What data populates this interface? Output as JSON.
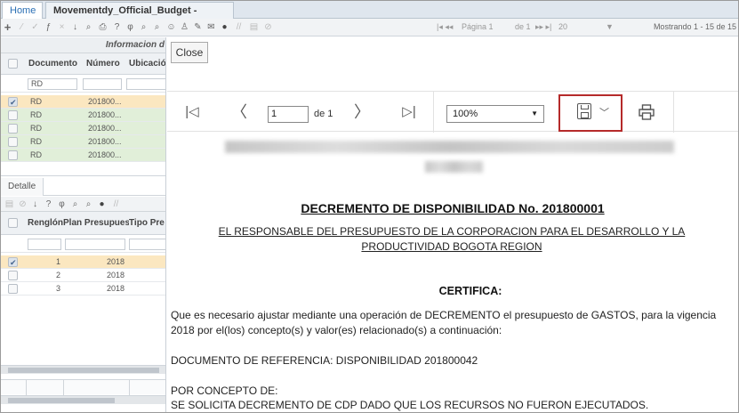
{
  "tabs": {
    "home": "Home",
    "document": "Movementdy_Official_Budget -[qmovo]",
    "close": "×"
  },
  "toolbar": {
    "pager_page_label": "Página 1",
    "pager_of": "de 1",
    "pager_size": "20",
    "showing": "Mostrando 1 - 15 de 15"
  },
  "left_panel": {
    "section_title": "Informacion d",
    "headers": {
      "documento": "Documento",
      "numero": "Número",
      "ubicacion": "Ubicació"
    },
    "filter_documento": "RD",
    "rows": [
      {
        "doc": "RD",
        "num": "201800...",
        "selected": true
      },
      {
        "doc": "RD",
        "num": "201800...",
        "selected": false
      },
      {
        "doc": "RD",
        "num": "201800...",
        "selected": false
      },
      {
        "doc": "RD",
        "num": "201800...",
        "selected": false
      },
      {
        "doc": "RD",
        "num": "201800...",
        "selected": false
      }
    ],
    "detalle_tab": "Detalle",
    "detail_headers": {
      "renglon": "Renglón",
      "plan": "Plan Presupuest",
      "tipo": "Tipo Pre"
    },
    "detail_rows": [
      {
        "renglon": "1",
        "plan": "2018",
        "selected": true
      },
      {
        "renglon": "2",
        "plan": "2018",
        "selected": false
      },
      {
        "renglon": "3",
        "plan": "2018",
        "selected": false
      }
    ]
  },
  "viewer": {
    "close_label": "Close",
    "page_value": "1",
    "of_pages": "de 1",
    "zoom": "100%"
  },
  "document": {
    "title": "DECREMENTO DE DISPONIBILIDAD No. 201800001",
    "subtitle_line1": "EL RESPONSABLE DEL PRESUPUESTO DE LA  CORPORACION PARA EL DESARROLLO Y LA",
    "subtitle_line2": "PRODUCTIVIDAD BOGOTA REGION",
    "certifica": "CERTIFICA:",
    "para1_line1": "Que es necesario ajustar mediante una operación de DECREMENTO el presupuesto de GASTOS, para la vigencia",
    "para1_line2": "2018 por el(los) concepto(s) y valor(es) relacionado(s) a continuación:",
    "referencia": "DOCUMENTO DE REFERENCIA: DISPONIBILIDAD 201800042",
    "por_concepto": "POR CONCEPTO DE:",
    "concepto_text": "SE SOLICITA DECREMENTO DE CDP DADO QUE LOS RECURSOS NO FUERON EJECUTADOS."
  },
  "colors": {
    "highlight_border": "#b52a2a",
    "selected_row": "#fbe7c0",
    "green_row": "#e1efd9"
  }
}
